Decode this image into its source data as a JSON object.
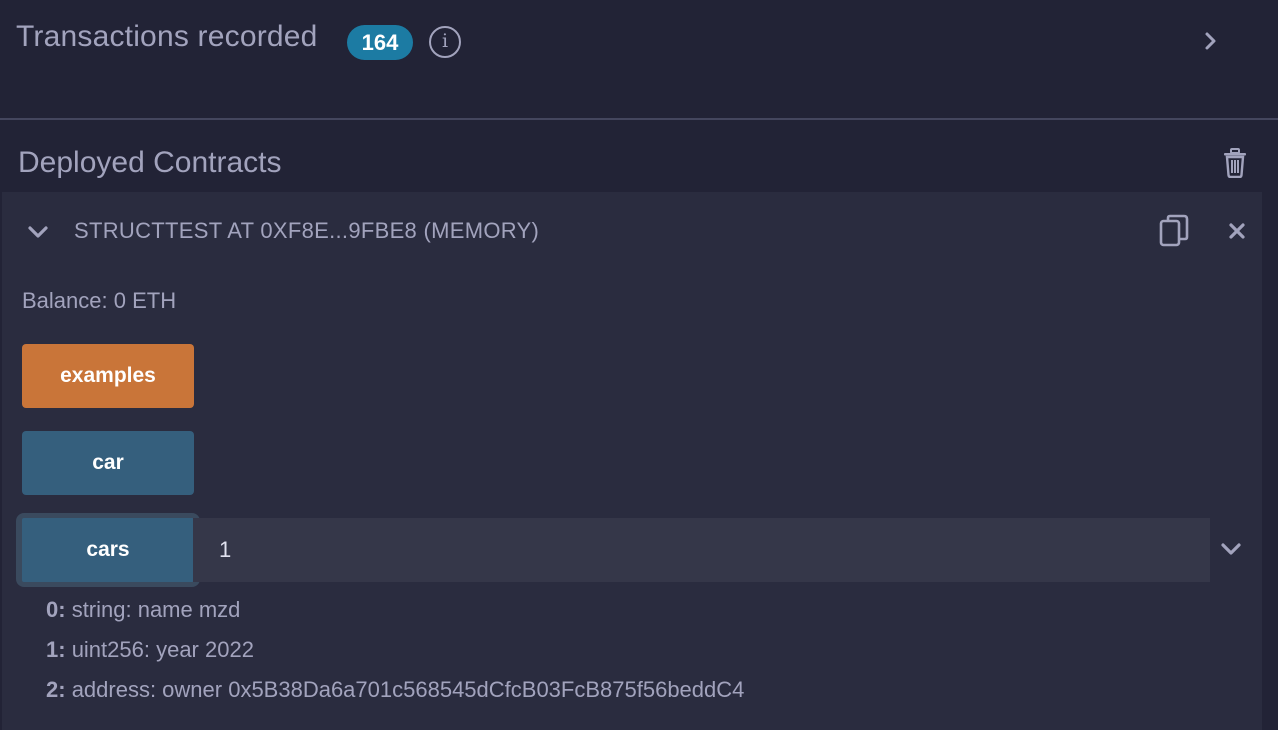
{
  "transactions": {
    "title": "Transactions recorded",
    "count": "164",
    "info_icon": "info-icon",
    "chevron_icon": "chevron-right-icon"
  },
  "deployed": {
    "title": "Deployed Contracts",
    "trash_icon": "trash-icon"
  },
  "instance": {
    "title": "STRUCTTEST AT 0XF8E...9FBE8 (MEMORY)",
    "balance": "Balance: 0 ETH",
    "caret_icon": "chevron-down-icon",
    "copy_icon": "copy-icon",
    "close_icon": "close-icon",
    "functions": [
      {
        "label": "examples",
        "color": "#c97539"
      },
      {
        "label": "car",
        "color": "#355f7d"
      },
      {
        "label": "cars",
        "color": "#355f7d",
        "input_value": "1"
      }
    ],
    "expand_icon": "chevron-down-icon",
    "outputs": [
      {
        "index": "0:",
        "text": "string: name mzd"
      },
      {
        "index": "1:",
        "text": "uint256: year 2022"
      },
      {
        "index": "2:",
        "text": "address: owner 0x5B38Da6a701c568545dCfcB03FcB875f56beddC4"
      }
    ]
  },
  "colors": {
    "background": "#222336",
    "panel": "#2a2c3f",
    "badge": "#1c7ba3",
    "text": "#a2a3bd",
    "payable_button": "#c97539",
    "call_button": "#355f7d"
  }
}
